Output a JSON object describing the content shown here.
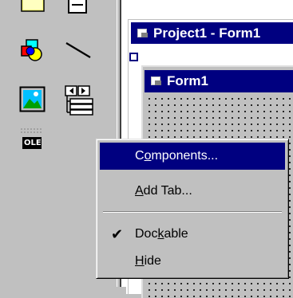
{
  "project_window": {
    "title": "Project1 - Form1"
  },
  "form_window": {
    "title": "Form1"
  },
  "toolbox": {
    "tools": [
      {
        "name": "label-tool-icon"
      },
      {
        "name": "textbox-tool-icon"
      },
      {
        "name": "shape-tool-icon"
      },
      {
        "name": "line-tool-icon"
      },
      {
        "name": "image-tool-icon"
      },
      {
        "name": "data-tool-icon"
      },
      {
        "name": "ole-tool-icon",
        "text": "OLE"
      }
    ]
  },
  "context_menu": {
    "items": [
      {
        "label_pre": "C",
        "label_accel": "o",
        "label_post": "mponents...",
        "highlighted": true
      },
      {
        "label_pre": "",
        "label_accel": "A",
        "label_post": "dd Tab...",
        "highlighted": false
      },
      {
        "label_pre": "Doc",
        "label_accel": "k",
        "label_post": "able",
        "checked": true,
        "check_glyph": "✔"
      },
      {
        "label_pre": "",
        "label_accel": "H",
        "label_post": "ide",
        "highlighted": false
      }
    ]
  },
  "colors": {
    "titlebar": "#000080",
    "menu_face": "#c0c0c0",
    "highlight": "#000080"
  }
}
